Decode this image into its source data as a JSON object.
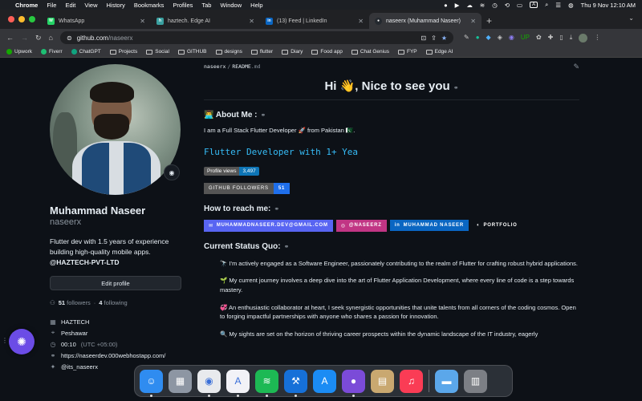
{
  "menubar": {
    "app": "Chrome",
    "menus": [
      "File",
      "Edit",
      "View",
      "History",
      "Bookmarks",
      "Profiles",
      "Tab",
      "Window",
      "Help"
    ],
    "input_source": "A",
    "datetime": "Thu 9 Nov  12:10 AM"
  },
  "tabs": [
    {
      "title": "WhatsApp",
      "color": "#25d366",
      "glyph": "W"
    },
    {
      "title": "haztech. Edge AI",
      "color": "#3aa0a0",
      "glyph": "h"
    },
    {
      "title": "(13) Feed | LinkedIn",
      "color": "#0a66c2",
      "glyph": "in"
    },
    {
      "title": "naseerx (Muhammad Naseer)",
      "color": "#e6edf3",
      "glyph": "●"
    }
  ],
  "toolbar": {
    "url_host": "github.com",
    "url_path": "/naseerx"
  },
  "bookmarks": [
    {
      "label": "Upwork",
      "type": "dot",
      "color": "#14a800"
    },
    {
      "label": "Fiverr",
      "type": "dot",
      "color": "#1dbf73"
    },
    {
      "label": "ChatGPT",
      "type": "dot",
      "color": "#10a37f"
    },
    {
      "label": "Projects",
      "type": "folder"
    },
    {
      "label": "Social",
      "type": "folder"
    },
    {
      "label": "GITHUB",
      "type": "folder"
    },
    {
      "label": "designs",
      "type": "folder"
    },
    {
      "label": "flutter",
      "type": "folder"
    },
    {
      "label": "Diary",
      "type": "folder"
    },
    {
      "label": "Food app",
      "type": "folder"
    },
    {
      "label": "Chat Genius",
      "type": "folder"
    },
    {
      "label": "FYP",
      "type": "folder"
    },
    {
      "label": "Edge AI",
      "type": "folder"
    }
  ],
  "profile": {
    "name": "Muhammad Naseer",
    "login": "naseerx",
    "bio": "Flutter dev with 1.5 years of experience building high-quality mobile apps.",
    "bio_org": "@HAZTECH-PVT-LTD",
    "edit_label": "Edit profile",
    "followers": "51",
    "followers_label": "followers",
    "following": "4",
    "following_label": "following",
    "company": "HAZTECH",
    "location": "Peshawar",
    "time": "00:10",
    "timezone": "(UTC +05:00)",
    "website": "https://naseerdev.000webhostapp.com/",
    "twitter": "@its_naseerx"
  },
  "readme": {
    "path_user": "naseerx",
    "path_file": "README",
    "path_ext": ".md",
    "greeting": "Hi 👋, Nice to see you",
    "about_heading": "👨‍💻 About Me :",
    "about_text": "I am a Full Stack Flutter Developer 🚀 from Pakistan 🇵🇰.",
    "typing_text": "Flutter Developer with 1+ Yea",
    "views_label": "Profile views",
    "views_value": "3,497",
    "followers_badge_label": "GITHUB FOLLOWERS",
    "followers_badge_value": "51",
    "reach_heading": "How to reach me:",
    "contacts": [
      {
        "label": "MUHAMMADNASEER.DEV@GMAIL.COM",
        "color": "#5865f2",
        "icon": "✉"
      },
      {
        "label": "@NASEERZ",
        "color": "#c13584",
        "icon": "◎"
      },
      {
        "label": "MUHAMMAD NASEER",
        "color": "#0a66c2",
        "icon": "in"
      },
      {
        "label": "PORTFOLIO",
        "color": "#0d1117",
        "icon": "◐"
      }
    ],
    "status_heading": "Current Status Quo:",
    "status_items": [
      "🔭 I'm actively engaged as a Software Engineer, passionately contributing to the realm of Flutter for crafting robust hybrid applications.",
      "🌱 My current journey involves a deep dive into the art of Flutter Application Development, where every line of code is a step towards mastery.",
      "💞 An enthusiastic collaborator at heart, I seek synergistic opportunities that unite talents from all corners of the coding cosmos. Open to forging impactful partnerships with anyone who shares a passion for innovation.",
      "🔍 My sights are set on the horizon of thriving career prospects within the dynamic landscape of the IT industry, eagerly"
    ]
  },
  "dock": [
    {
      "name": "finder",
      "color": "#2f8cf0",
      "glyph": "☺",
      "run": true
    },
    {
      "name": "launchpad",
      "color": "#8d96a3",
      "glyph": "▦",
      "run": false
    },
    {
      "name": "chrome",
      "color": "#e8eaed",
      "glyph": "◉",
      "run": true
    },
    {
      "name": "xcode-instruments",
      "color": "#f2f2f7",
      "glyph": "A",
      "run": true
    },
    {
      "name": "spotify",
      "color": "#1db954",
      "glyph": "≋",
      "run": true
    },
    {
      "name": "xcode",
      "color": "#1670d8",
      "glyph": "⚒",
      "run": true
    },
    {
      "name": "app-store",
      "color": "#1b8cf4",
      "glyph": "A",
      "run": false
    },
    {
      "name": "github-desktop",
      "color": "#7b4bd8",
      "glyph": "●",
      "run": true
    },
    {
      "name": "archive-utility",
      "color": "#c9a870",
      "glyph": "▤",
      "run": false
    },
    {
      "name": "music",
      "color": "#fa3c55",
      "glyph": "♫",
      "run": false
    },
    {
      "name": "downloads",
      "color": "#5ba7ea",
      "glyph": "▬",
      "run": false
    },
    {
      "name": "trash",
      "color": "#7c7f85",
      "glyph": "▥",
      "run": false
    }
  ]
}
